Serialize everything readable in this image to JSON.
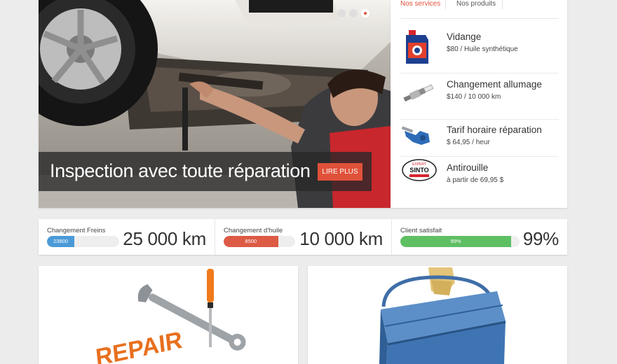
{
  "slider": {
    "caption": "Inspection avec toute réparation",
    "button_label": "LIRE PLUS",
    "dots_count": 3,
    "active_dot": 3,
    "accent_color": "#e0513a"
  },
  "services_panel": {
    "tabs": [
      "Nos services",
      "Nos produits"
    ],
    "active_tab": "Nos services",
    "items": [
      {
        "name": "Vidange",
        "price": "$80 / Huile synthétique",
        "icon": "motor-oil-can-icon"
      },
      {
        "name": "Changement allumage",
        "price": "$140 / 10 000 km",
        "icon": "spark-plug-icon"
      },
      {
        "name": "Tarif horaire réparation",
        "price": "$ 64,95 / heur",
        "icon": "mechanic-hand-tool-icon"
      },
      {
        "name": "Antirouille",
        "price": "à partir de 69,95 $",
        "icon": "sinto-logo-icon",
        "logo_text": [
          "EXPERT",
          "SINTO"
        ]
      }
    ]
  },
  "stats": [
    {
      "label": "Changement Freins",
      "bar_text": "23800",
      "progress_percent": 38,
      "value": "25 000 km",
      "color": "#4a9ad8"
    },
    {
      "label": "Changement d'huile",
      "bar_text": "8500",
      "progress_percent": 76,
      "value": "10 000 km",
      "color": "#dd5a44"
    },
    {
      "label": "Client satisfait",
      "bar_text": "99%",
      "progress_percent": 93,
      "value": "99%",
      "color": "#5fbf63"
    }
  ],
  "cards": [
    {
      "image": "repair-tools-illustration",
      "image_text": "REPAIR"
    },
    {
      "image": "blue-toolbox-illustration"
    }
  ]
}
